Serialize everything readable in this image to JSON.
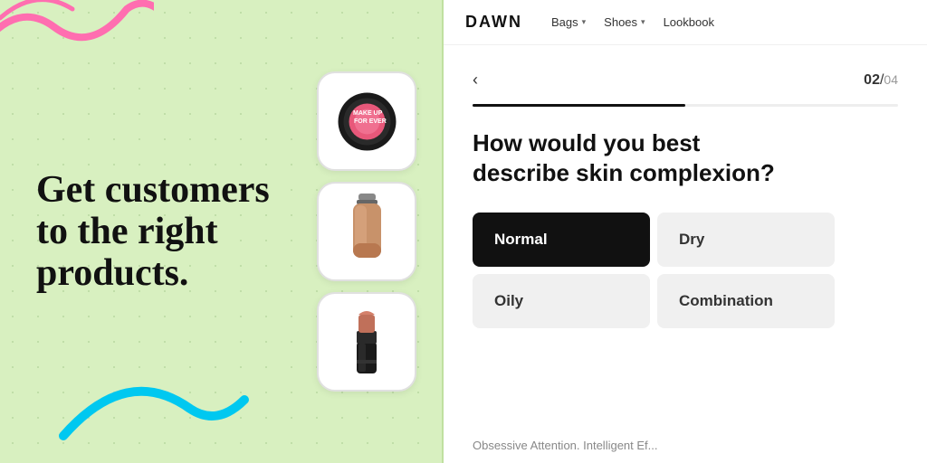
{
  "left": {
    "headline": "Get customers to the right products."
  },
  "navbar": {
    "logo": "DAWN",
    "links": [
      {
        "label": "Bags",
        "hasDropdown": true
      },
      {
        "label": "Shoes",
        "hasDropdown": true
      },
      {
        "label": "Lookbook",
        "hasDropdown": false
      }
    ]
  },
  "quiz": {
    "step": "02",
    "total": "04",
    "progress_pct": 50,
    "back_label": "‹",
    "question": "How would you best describe skin complexion?",
    "answers": [
      {
        "label": "Normal",
        "selected": true
      },
      {
        "label": "Dry",
        "selected": false
      },
      {
        "label": "Oily",
        "selected": false
      },
      {
        "label": "Combination",
        "selected": false
      }
    ],
    "bottom_text": "Obsessive Attention. Intelligent Ef..."
  },
  "colors": {
    "selected_bg": "#111111",
    "unselected_bg": "#f0f0f0",
    "progress_fill": "#111111",
    "left_bg": "#d8f0c0"
  }
}
